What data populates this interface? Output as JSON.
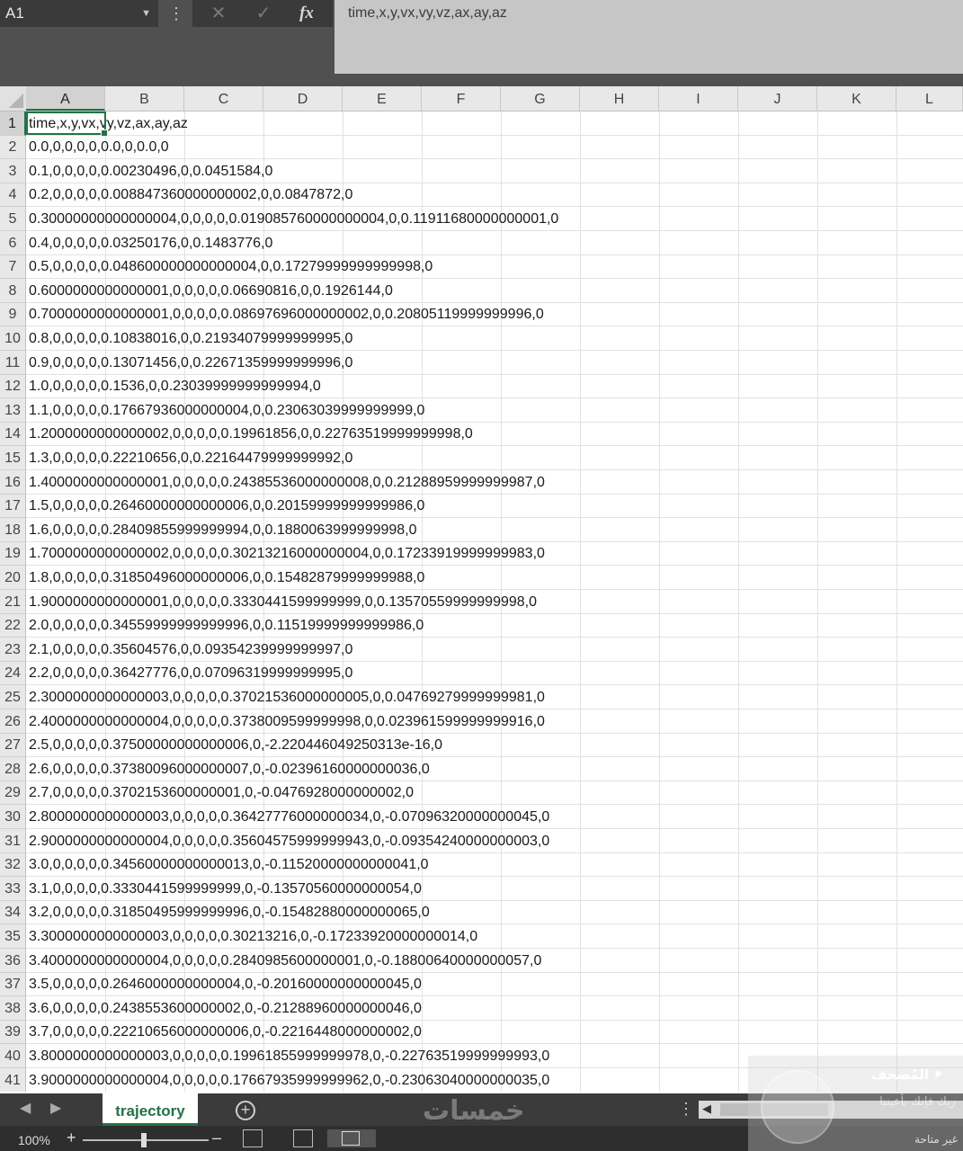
{
  "name_box": {
    "value": "A1"
  },
  "formula_bar": {
    "fx": "fx",
    "value": "time,x,y,vx,vy,vz,ax,ay,az"
  },
  "columns": [
    "A",
    "B",
    "C",
    "D",
    "E",
    "F",
    "G",
    "H",
    "I",
    "J",
    "K",
    "L"
  ],
  "rows": [
    {
      "n": "1",
      "a": "time,x,y,vx,vy,vz,ax,ay,az"
    },
    {
      "n": "2",
      "a": "0.0,0,0,0,0,0.0,0,0.0,0"
    },
    {
      "n": "3",
      "a": "0.1,0,0,0,0,0.00230496,0,0.0451584,0"
    },
    {
      "n": "4",
      "a": "0.2,0,0,0,0,0.008847360000000002,0,0.0847872,0"
    },
    {
      "n": "5",
      "a": "0.30000000000000004,0,0,0,0,0.019085760000000004,0,0.11911680000000001,0"
    },
    {
      "n": "6",
      "a": "0.4,0,0,0,0,0.03250176,0,0.1483776,0"
    },
    {
      "n": "7",
      "a": "0.5,0,0,0,0,0.048600000000000004,0,0.17279999999999998,0"
    },
    {
      "n": "8",
      "a": "0.6000000000000001,0,0,0,0,0.06690816,0,0.1926144,0"
    },
    {
      "n": "9",
      "a": "0.7000000000000001,0,0,0,0,0.08697696000000002,0,0.20805119999999996,0"
    },
    {
      "n": "10",
      "a": "0.8,0,0,0,0,0.10838016,0,0.21934079999999995,0"
    },
    {
      "n": "11",
      "a": "0.9,0,0,0,0,0.13071456,0,0.22671359999999996,0"
    },
    {
      "n": "12",
      "a": "1.0,0,0,0,0,0.1536,0,0.23039999999999994,0"
    },
    {
      "n": "13",
      "a": "1.1,0,0,0,0,0.17667936000000004,0,0.23063039999999999,0"
    },
    {
      "n": "14",
      "a": "1.2000000000000002,0,0,0,0,0.19961856,0,0.22763519999999998,0"
    },
    {
      "n": "15",
      "a": "1.3,0,0,0,0,0.22210656,0,0.22164479999999992,0"
    },
    {
      "n": "16",
      "a": "1.4000000000000001,0,0,0,0,0.24385536000000008,0,0.21288959999999987,0"
    },
    {
      "n": "17",
      "a": "1.5,0,0,0,0,0.26460000000000006,0,0.20159999999999986,0"
    },
    {
      "n": "18",
      "a": "1.6,0,0,0,0,0.28409855999999994,0,0.1880063999999998,0"
    },
    {
      "n": "19",
      "a": "1.7000000000000002,0,0,0,0,0.30213216000000004,0,0.17233919999999983,0"
    },
    {
      "n": "20",
      "a": "1.8,0,0,0,0,0.31850496000000006,0,0.15482879999999988,0"
    },
    {
      "n": "21",
      "a": "1.9000000000000001,0,0,0,0,0.3330441599999999,0,0.13570559999999998,0"
    },
    {
      "n": "22",
      "a": "2.0,0,0,0,0,0.34559999999999996,0,0.11519999999999986,0"
    },
    {
      "n": "23",
      "a": "2.1,0,0,0,0,0.35604576,0,0.09354239999999997,0"
    },
    {
      "n": "24",
      "a": "2.2,0,0,0,0,0.36427776,0,0.07096319999999995,0"
    },
    {
      "n": "25",
      "a": "2.3000000000000003,0,0,0,0,0.37021536000000005,0,0.04769279999999981,0"
    },
    {
      "n": "26",
      "a": "2.4000000000000004,0,0,0,0,0.3738009599999998,0,0.023961599999999916,0"
    },
    {
      "n": "27",
      "a": "2.5,0,0,0,0,0.37500000000000006,0,-2.220446049250313e-16,0"
    },
    {
      "n": "28",
      "a": "2.6,0,0,0,0,0.37380096000000007,0,-0.02396160000000036,0"
    },
    {
      "n": "29",
      "a": "2.7,0,0,0,0,0.3702153600000001,0,-0.0476928000000002,0"
    },
    {
      "n": "30",
      "a": "2.8000000000000003,0,0,0,0,0.36427776000000034,0,-0.07096320000000045,0"
    },
    {
      "n": "31",
      "a": "2.9000000000000004,0,0,0,0,0.35604575999999943,0,-0.09354240000000003,0"
    },
    {
      "n": "32",
      "a": "3.0,0,0,0,0,0.34560000000000013,0,-0.11520000000000041,0"
    },
    {
      "n": "33",
      "a": "3.1,0,0,0,0,0.3330441599999999,0,-0.13570560000000054,0"
    },
    {
      "n": "34",
      "a": "3.2,0,0,0,0,0.31850495999999996,0,-0.15482880000000065,0"
    },
    {
      "n": "35",
      "a": "3.3000000000000003,0,0,0,0,0.30213216,0,-0.17233920000000014,0"
    },
    {
      "n": "36",
      "a": "3.4000000000000004,0,0,0,0,0.2840985600000001,0,-0.18800640000000057,0"
    },
    {
      "n": "37",
      "a": "3.5,0,0,0,0,0.2646000000000004,0,-0.20160000000000045,0"
    },
    {
      "n": "38",
      "a": "3.6,0,0,0,0,0.2438553600000002,0,-0.21288960000000046,0"
    },
    {
      "n": "39",
      "a": "3.7,0,0,0,0,0.22210656000000006,0,-0.2216448000000002,0"
    },
    {
      "n": "40",
      "a": "3.8000000000000003,0,0,0,0,0.19961855999999978,0,-0.22763519999999993,0"
    },
    {
      "n": "41",
      "a": "3.9000000000000004,0,0,0,0,0.17667935999999962,0,-0.23063040000000035,0"
    }
  ],
  "sheet_tabs": [
    {
      "label": "trajectory",
      "active": true
    }
  ],
  "status": {
    "zoom": "100%"
  },
  "colors": {
    "accent": "#217346"
  },
  "watermark": {
    "text": "خمسات"
  },
  "notification": {
    "title": "المُصحف",
    "subtitle": "ربك فإنك بأعيننا",
    "status": "غير متاحة"
  }
}
